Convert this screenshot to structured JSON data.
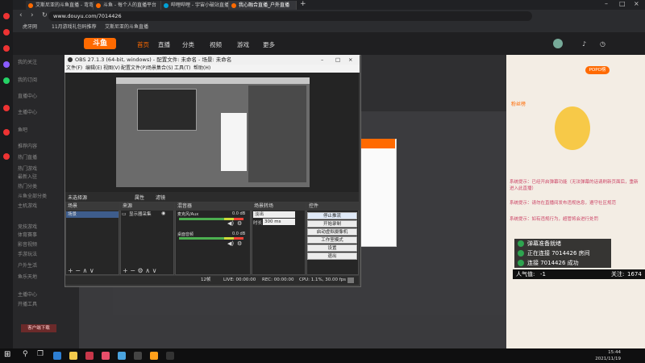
{
  "browser": {
    "tabs": [
      {
        "label": "艾斯尼亚的斗鱼直播 - 弯弯",
        "active": false
      },
      {
        "label": "斗鱼 - 每个人的直播平台",
        "active": false
      },
      {
        "label": "哔哩哔哩 - 宇宙小破站直播",
        "active": false
      },
      {
        "label": "我心融合直播_户外直播",
        "active": true
      }
    ],
    "url": "www.douyu.com/7014426",
    "bookmarks": [
      "虎牙网",
      "11月游戏礼包码推荐",
      "艾斯尼亚的斗鱼直播"
    ]
  },
  "site": {
    "logo": "斗鱼",
    "nav": [
      "首页",
      "直播",
      "分类",
      "视频",
      "游戏",
      "更多"
    ],
    "sidebar": [
      "我的关注",
      "我的订阅",
      "直播中心",
      "主播中心",
      "鱼吧",
      "推荐内容",
      "热门直播",
      "热门游戏",
      "最新入驻",
      "热门分类",
      "斗鱼全部分类",
      "主机游戏",
      "竞技游戏",
      "体育赛事",
      "影音视频",
      "手游玩法",
      "户外生活",
      "鱼乐天地",
      "主播中心",
      "开播工具"
    ],
    "sidebar_bottom": "客户端下载",
    "right_panel": {
      "badge": "POPO榜",
      "rank_label": "粉丝榜",
      "chat_lines": [
        "系统提示：已经开启弹幕功能（无法弹幕的话请刷新页面后，重新进入此直播）",
        "系统提示：请勿在直播间发布违规信息，遵守社区规范",
        "系统提示：如有违规行为，超管将会进行处罚"
      ]
    }
  },
  "obs": {
    "title": "OBS 27.1.3 (64-bit, windows) - 配置文件: 未命名 - 场景: 未命名",
    "menu": [
      "文件(F)",
      "编辑(E)",
      "视图(V)",
      "配置文件(P)",
      "场景集合(S)",
      "工具(T)",
      "帮助(H)"
    ],
    "source_status": "未选择源",
    "props_btn": "属性",
    "filters_btn": "滤镜",
    "docks": {
      "scenes": {
        "title": "场景",
        "items": [
          "场景"
        ]
      },
      "sources": {
        "title": "来源",
        "items": [
          "显示器采集"
        ]
      },
      "mixer": {
        "title": "混音器",
        "tracks": [
          {
            "name": "麦克风/Aux",
            "db": "0.0 dB"
          },
          {
            "name": "桌面音频",
            "db": "0.0 dB"
          }
        ]
      },
      "transitions": {
        "title": "场景转场",
        "type": "淡出",
        "duration_label": "时长",
        "duration": "300 ms"
      },
      "controls": {
        "title": "控件",
        "buttons": [
          "停止推流",
          "开始录制",
          "启动虚拟摄像机",
          "工作室模式",
          "设置",
          "退出"
        ]
      }
    },
    "status": {
      "live": "LIVE: 00:00:00",
      "rec": "REC: 00:00:00",
      "cpu": "CPU: 1.1%, 30.00 fps",
      "dropped": "12帧"
    }
  },
  "notifications": [
    "弹幕准备就绪",
    "正在连接 7014426 房间",
    "连接 7014426 成功"
  ],
  "stats": {
    "popularity_label": "人气值:",
    "popularity": "-1",
    "follow_label": "关注:",
    "follow": "1674"
  },
  "taskbar": {
    "time": "15:44",
    "date": "2021/11/19"
  }
}
